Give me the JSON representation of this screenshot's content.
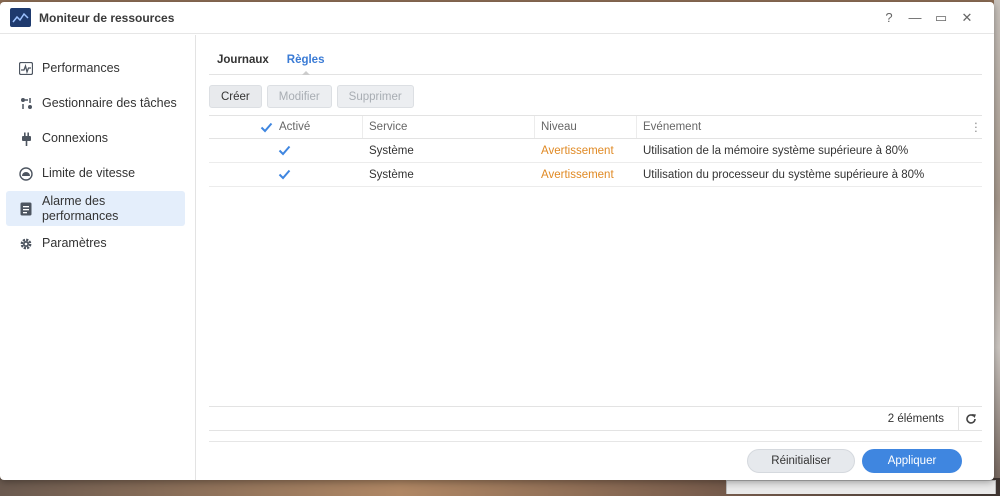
{
  "window": {
    "title": "Moniteur de ressources",
    "controls": {
      "help": "?",
      "minimize": "—",
      "maximize": "▭",
      "close": "✕"
    }
  },
  "sidebar": {
    "items": [
      {
        "label": "Performances",
        "icon": "performance-chart-icon"
      },
      {
        "label": "Gestionnaire des tâches",
        "icon": "task-manager-icon"
      },
      {
        "label": "Connexions",
        "icon": "plug-icon"
      },
      {
        "label": "Limite de vitesse",
        "icon": "speed-gauge-icon"
      },
      {
        "label": "Alarme des performances",
        "icon": "alarm-clipboard-icon",
        "active": true
      },
      {
        "label": "Paramètres",
        "icon": "gear-icon"
      }
    ]
  },
  "tabs": [
    {
      "label": "Journaux"
    },
    {
      "label": "Règles",
      "active": true
    }
  ],
  "toolbar": {
    "create": "Créer",
    "modify": "Modifier",
    "delete": "Supprimer"
  },
  "table": {
    "headers": {
      "active": "Activé",
      "service": "Service",
      "level": "Niveau",
      "event": "Evénement"
    },
    "rows": [
      {
        "active": true,
        "service": "Système",
        "level": "Avertissement",
        "event": "Utilisation de la mémoire système supérieure à 80%"
      },
      {
        "active": true,
        "service": "Système",
        "level": "Avertissement",
        "event": "Utilisation du processeur du système supérieure à 80%"
      }
    ],
    "count": "2 éléments"
  },
  "actions": {
    "reset": "Réinitialiser",
    "apply": "Appliquer"
  },
  "colors": {
    "accent": "#3f86e0",
    "warning": "#e08a25",
    "active_bg": "#e4eefb"
  }
}
